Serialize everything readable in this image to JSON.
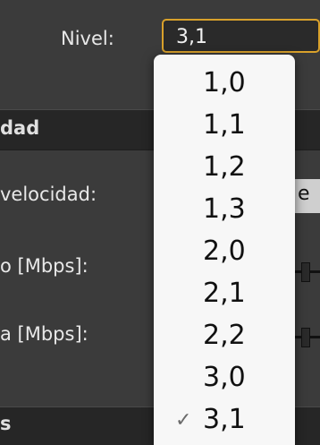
{
  "level_row": {
    "label": "Nivel:",
    "selected_value": "3,1"
  },
  "sections": [
    {
      "title": "dad"
    },
    {
      "title": "s"
    }
  ],
  "rows": [
    {
      "label": "velocidad:"
    },
    {
      "label": "o [Mbps]:"
    },
    {
      "label": "a [Mbps]:"
    }
  ],
  "behind_select_text": "e",
  "dropdown": {
    "options": [
      {
        "label": "1,0",
        "checked": false
      },
      {
        "label": "1,1",
        "checked": false
      },
      {
        "label": "1,2",
        "checked": false
      },
      {
        "label": "1,3",
        "checked": false
      },
      {
        "label": "2,0",
        "checked": false
      },
      {
        "label": "2,1",
        "checked": false
      },
      {
        "label": "2,2",
        "checked": false
      },
      {
        "label": "3,0",
        "checked": false
      },
      {
        "label": "3,1",
        "checked": true
      }
    ],
    "check_glyph": "✓"
  }
}
